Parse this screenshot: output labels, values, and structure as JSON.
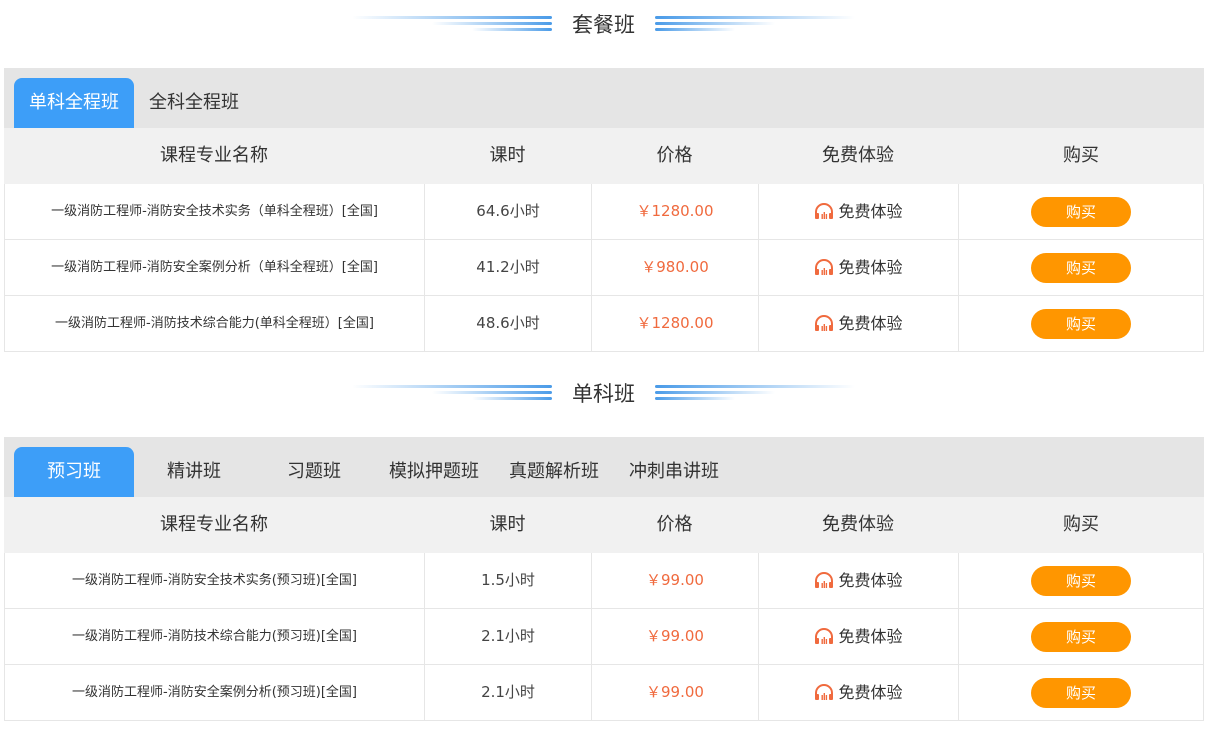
{
  "package_section": {
    "title": "套餐班",
    "tabs": [
      {
        "label": "单科全程班",
        "active": true
      },
      {
        "label": "全科全程班",
        "active": false
      }
    ],
    "headers": [
      "课程专业名称",
      "课时",
      "价格",
      "免费体验",
      "购买"
    ],
    "rows": [
      {
        "name": "一级消防工程师-消防安全技术实务（单科全程班）[全国]",
        "hours": "64.6小时",
        "price": "￥1280.00",
        "trial": "免费体验",
        "buy": "购买"
      },
      {
        "name": "一级消防工程师-消防安全案例分析（单科全程班）[全国]",
        "hours": "41.2小时",
        "price": "￥980.00",
        "trial": "免费体验",
        "buy": "购买"
      },
      {
        "name": "一级消防工程师-消防技术综合能力(单科全程班）[全国]",
        "hours": "48.6小时",
        "price": "￥1280.00",
        "trial": "免费体验",
        "buy": "购买"
      }
    ]
  },
  "single_section": {
    "title": "单科班",
    "tabs": [
      {
        "label": "预习班",
        "active": true
      },
      {
        "label": "精讲班",
        "active": false
      },
      {
        "label": "习题班",
        "active": false
      },
      {
        "label": "模拟押题班",
        "active": false
      },
      {
        "label": "真题解析班",
        "active": false
      },
      {
        "label": "冲刺串讲班",
        "active": false
      }
    ],
    "headers": [
      "课程专业名称",
      "课时",
      "价格",
      "免费体验",
      "购买"
    ],
    "rows": [
      {
        "name": "一级消防工程师-消防安全技术实务(预习班)[全国]",
        "hours": "1.5小时",
        "price": "￥99.00",
        "trial": "免费体验",
        "buy": "购买"
      },
      {
        "name": "一级消防工程师-消防技术综合能力(预习班)[全国]",
        "hours": "2.1小时",
        "price": "￥99.00",
        "trial": "免费体验",
        "buy": "购买"
      },
      {
        "name": "一级消防工程师-消防安全案例分析(预习班)[全国]",
        "hours": "2.1小时",
        "price": "￥99.00",
        "trial": "免费体验",
        "buy": "购买"
      }
    ]
  },
  "icons": {
    "trial": "headphones-icon"
  },
  "colors": {
    "tab_active": "#3d9ef8",
    "price": "#f06a3e",
    "buy_button": "#ff9600",
    "headphones": "#f06a3e",
    "title_lines": "#4a9be8"
  }
}
